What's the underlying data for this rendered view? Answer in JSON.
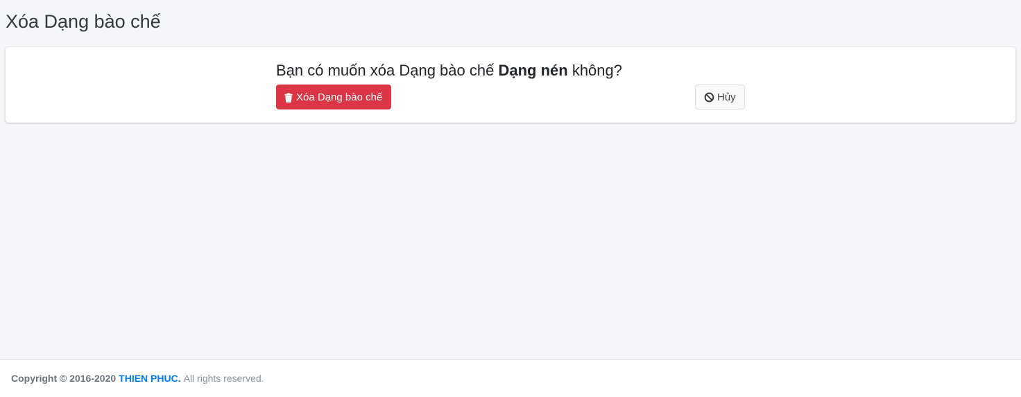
{
  "page": {
    "title": "Xóa Dạng bào chế"
  },
  "confirm": {
    "question_prefix": "Bạn có muốn xóa Dạng bào chế",
    "item_name": "Dạng nén",
    "question_suffix": "không?",
    "delete_button_label": "Xóa Dạng bào chế",
    "delete_icon": "trash-icon",
    "cancel_button_label": "Hủy",
    "cancel_icon": "ban-icon"
  },
  "footer": {
    "copyright": "Copyright © 2016-2020",
    "brand": "THIEN PHUC.",
    "rights": "All rights reserved."
  },
  "colors": {
    "background": "#f4f6f9",
    "danger": "#dc3545",
    "brand_link": "#007bff"
  }
}
